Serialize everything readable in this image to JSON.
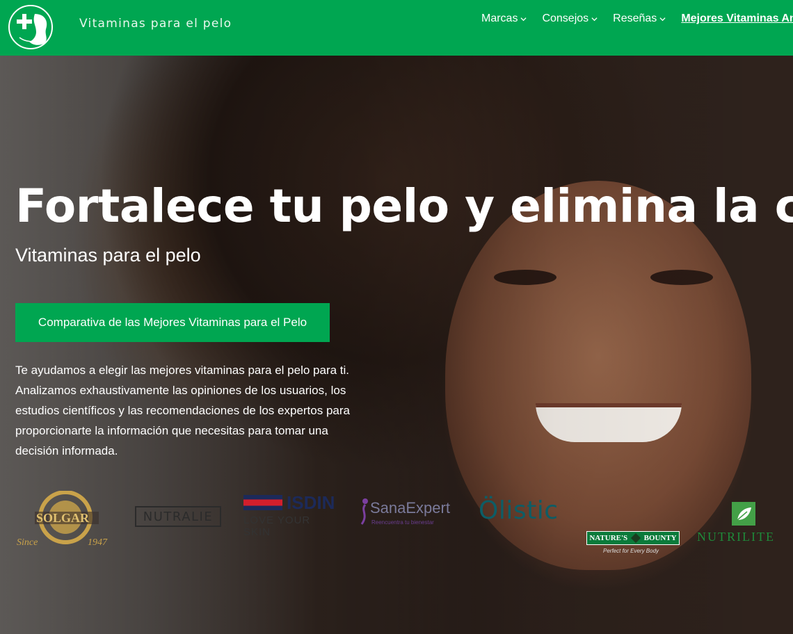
{
  "header": {
    "site_name": "Vitaminas para el pelo",
    "logo_icon": "health-hair-logo-icon",
    "nav": [
      {
        "label": "Marcas",
        "dropdown": true
      },
      {
        "label": "Consejos",
        "dropdown": true
      },
      {
        "label": "Reseñas",
        "dropdown": true
      },
      {
        "label": "Mejores Vitaminas Ant",
        "dropdown": false,
        "active": true
      }
    ]
  },
  "hero": {
    "title": "Fortalece tu pelo y elimina la caída",
    "subtitle": "Vitaminas para el pelo",
    "cta_label": "Comparativa de las Mejores Vitaminas para el Pelo",
    "description": "Te ayudamos a elegir las mejores vitaminas para el pelo para ti. Analizamos exhaustivamente las opiniones de los usuarios, los estudios científicos y las recomendaciones de los expertos para proporcionarte la información que necesitas para tomar una decisión informada."
  },
  "brands": {
    "solgar": {
      "name": "SOLGAR",
      "since": "Since",
      "year": "1947"
    },
    "nutralie": "NUTRALIE",
    "isdin": {
      "name": "ISDIN",
      "tagline": "LOVE YOUR SKIN"
    },
    "sana": {
      "name": "SanaExpert",
      "tagline": "Reencuentra tu bienestar"
    },
    "olistic": "Ölistic",
    "natures": {
      "left": "NATURE'S",
      "right": "BOUNTY",
      "tagline": "Perfect for Every Body"
    },
    "nutrilite": "NUTRILITE"
  },
  "colors": {
    "brand_green": "#00a651",
    "text_white": "#ffffff"
  }
}
